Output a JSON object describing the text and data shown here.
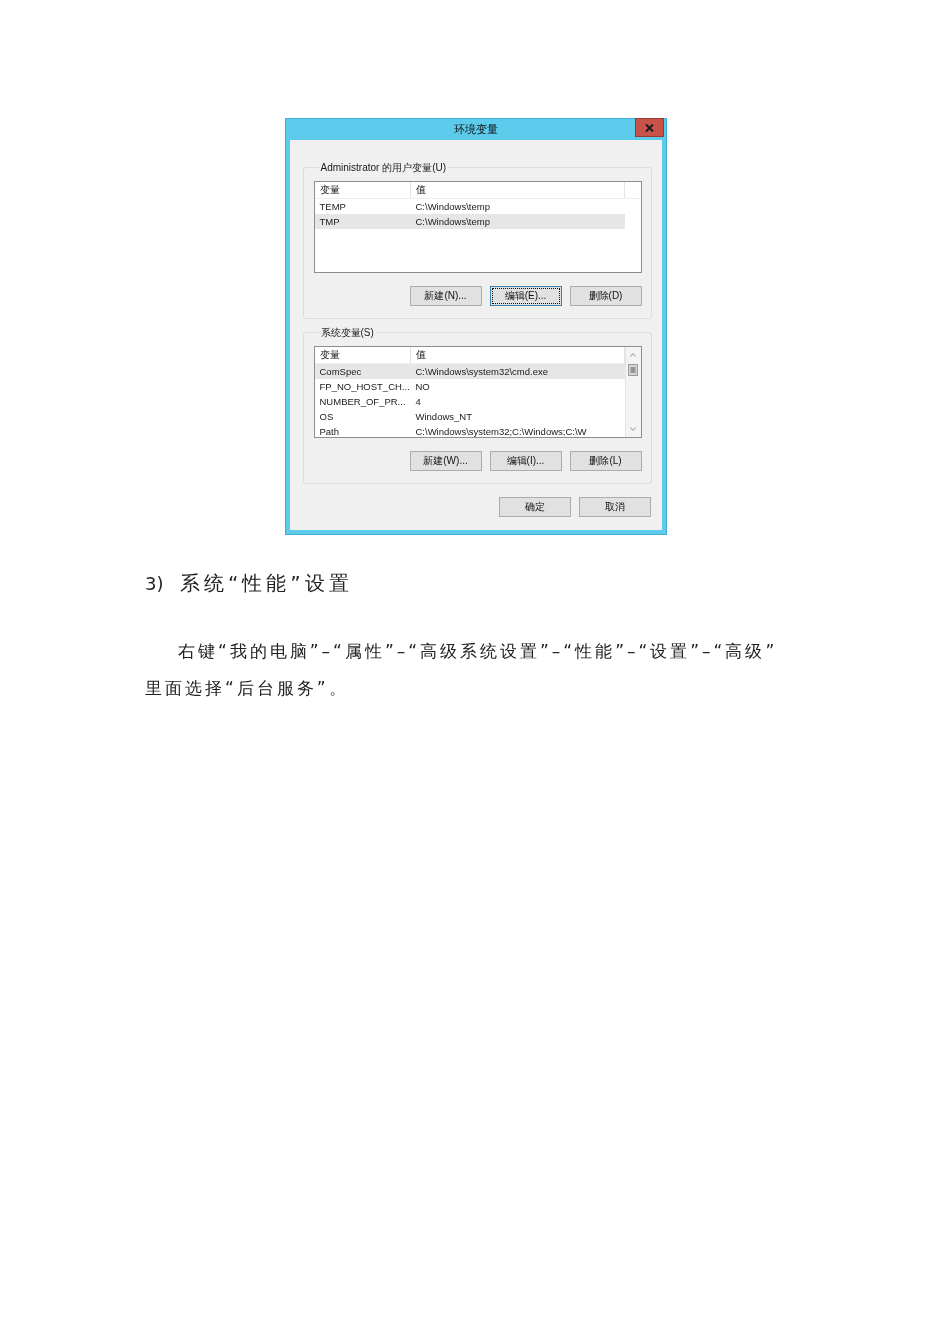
{
  "dialog": {
    "title": "环境变量",
    "user_variables": {
      "label": "Administrator 的用户变量(U)",
      "scrollbar": false,
      "columns": [
        "变量",
        "值"
      ],
      "rows": [
        {
          "name": "TEMP",
          "value": "C:\\Windows\\temp",
          "selected": false
        },
        {
          "name": "TMP",
          "value": "C:\\Windows\\temp",
          "selected": true
        }
      ],
      "buttons": [
        {
          "label": "新建(N)...",
          "focused": false
        },
        {
          "label": "编辑(E)...",
          "focused": true
        },
        {
          "label": "删除(D)",
          "focused": false
        }
      ]
    },
    "system_variables": {
      "label": "系统变量(S)",
      "scrollbar": true,
      "columns": [
        "变量",
        "值"
      ],
      "rows": [
        {
          "name": "ComSpec",
          "value": "C:\\Windows\\system32\\cmd.exe",
          "selected": true
        },
        {
          "name": "FP_NO_HOST_CH...",
          "value": "NO",
          "selected": false
        },
        {
          "name": "NUMBER_OF_PR...",
          "value": "4",
          "selected": false
        },
        {
          "name": "OS",
          "value": "Windows_NT",
          "selected": false
        },
        {
          "name": "Path",
          "value": "C:\\Windows\\system32;C:\\Windows;C:\\W",
          "selected": false
        }
      ],
      "buttons": [
        {
          "label": "新建(W)...",
          "focused": false
        },
        {
          "label": "编辑(I)...",
          "focused": false
        },
        {
          "label": "删除(L)",
          "focused": false
        }
      ]
    },
    "buttons": [
      {
        "label": "确定",
        "focused": false
      },
      {
        "label": "取消",
        "focused": false
      }
    ]
  },
  "section": {
    "number": "3)",
    "title": "系统“性能”设置"
  },
  "paragraph": {
    "lines": [
      "右键“我的电脑”–“属性”–“高级系统设置”–“性能”–“设置”–“高级”",
      "里面选择“后台服务”。"
    ]
  }
}
